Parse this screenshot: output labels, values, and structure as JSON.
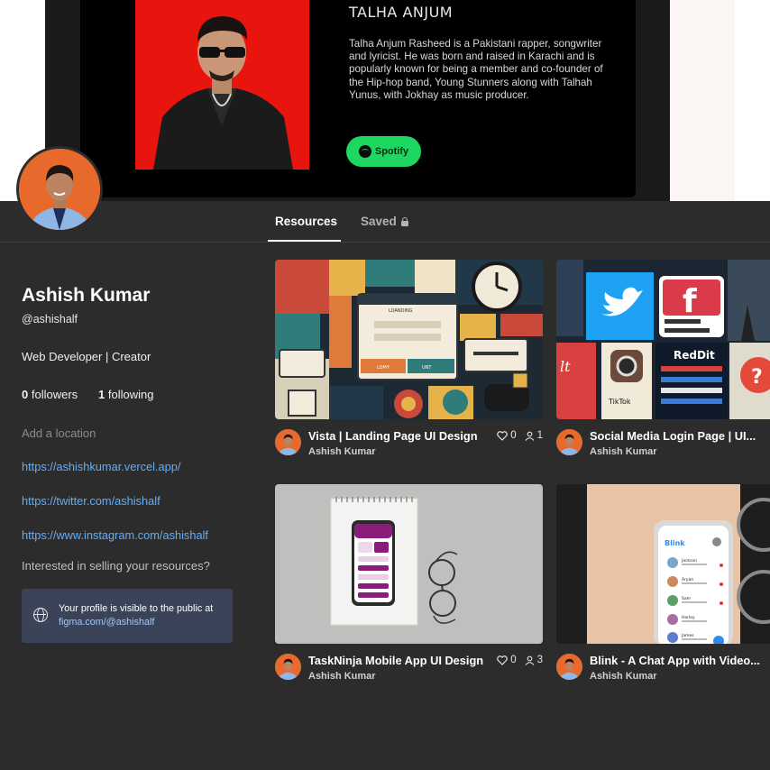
{
  "banner": {
    "title": "TALHA ANJUM",
    "description": "Talha Anjum Rasheed is a Pakistani rapper, songwriter and lyricist. He was born and raised in Karachi and is popularly known for being a member and co-founder of the Hip-hop band, Young Stunners along with Talhah Yunus, with Jokhay as music producer.",
    "button_label": "Spotify",
    "button_icon": "spotify-icon",
    "colors": {
      "photo_bg": "#e8140e",
      "button": "#1ed760"
    }
  },
  "tabs": {
    "resources": "Resources",
    "saved": "Saved",
    "saved_icon": "lock-icon"
  },
  "profile": {
    "name": "Ashish Kumar",
    "handle": "@ashishalf",
    "bio": "Web Developer | Creator",
    "followers_count": "0",
    "followers_label": "followers",
    "following_count": "1",
    "following_label": "following",
    "location_placeholder": "Add a location",
    "links": [
      "https://ashishkumar.vercel.app/",
      "https://twitter.com/ashishalf",
      "https://www.instagram.com/ashishalf"
    ],
    "sell_prompt": "Interested in selling your resources?",
    "notice_text": "Your profile is visible to the public at",
    "notice_link": "figma.com/@ashishalf",
    "notice_icon": "globe-icon"
  },
  "cards": [
    {
      "title": "Vista | Landing Page UI Design",
      "author": "Ashish Kumar",
      "likes": "0",
      "users": "1"
    },
    {
      "title": "Social Media Login Page | UI...",
      "author": "Ashish Kumar"
    },
    {
      "title": "TaskNinja Mobile App UI Design",
      "author": "Ashish Kumar",
      "likes": "0",
      "users": "3"
    },
    {
      "title": "Blink - A Chat App with Video...",
      "author": "Ashish Kumar"
    }
  ],
  "thumb_text": {
    "vista_label": "LOANDING",
    "vista_btn_a": "LOMY",
    "vista_btn_b": "UNT",
    "reddit": "RedDit",
    "tiktok": "TikTok",
    "blink": "Blink",
    "chat_names": [
      "Jackson",
      "Aryan",
      "Sam",
      "Harley",
      "James"
    ]
  },
  "colors": {
    "background": "#2c2c2c",
    "link": "#63aef7",
    "notice_bg": "#3b4358"
  }
}
